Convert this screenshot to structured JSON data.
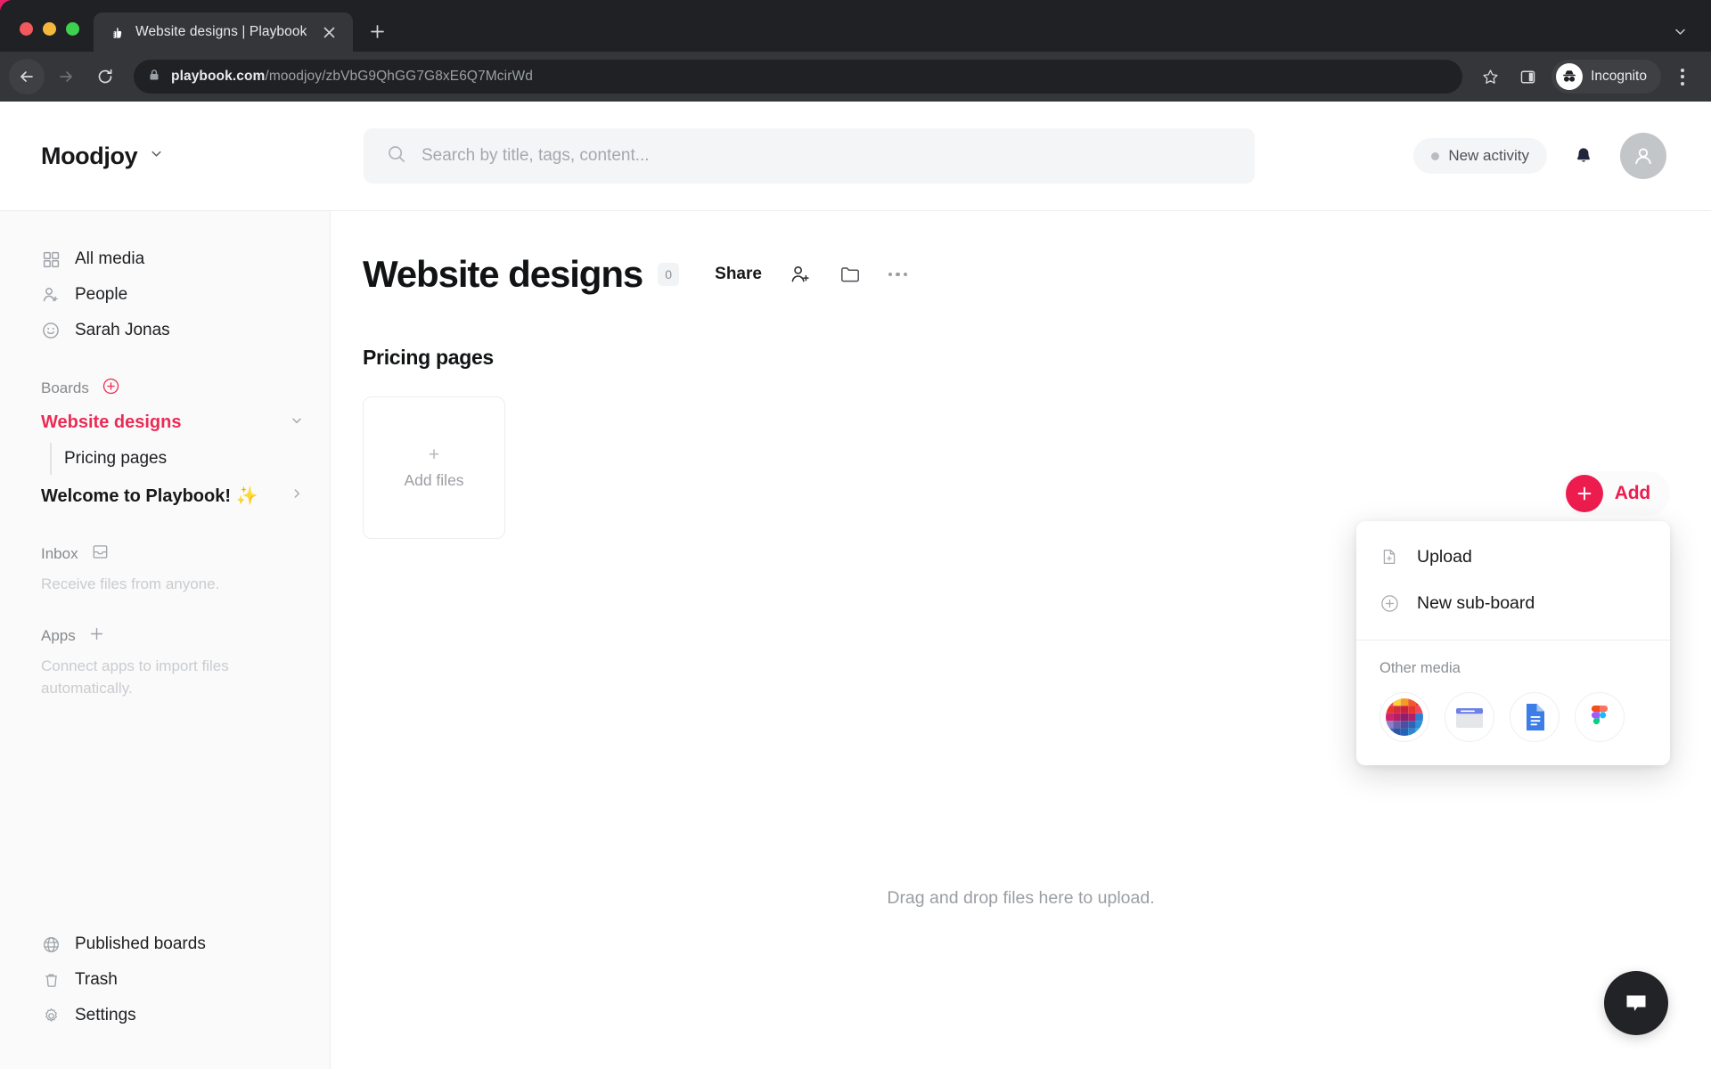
{
  "browser": {
    "tab": {
      "title": "Website designs | Playbook",
      "favicon_icon": "playbook-thumb-icon",
      "close_icon": "close-icon"
    },
    "new_tab_icon": "plus-icon",
    "tab_list_caret_icon": "chevron-down-icon",
    "back_icon": "arrow-left-icon",
    "forward_icon": "arrow-right-icon",
    "reload_icon": "reload-icon",
    "lock_icon": "lock-icon",
    "url_domain": "playbook.com",
    "url_path": "/moodjoy/zbVbG9QhGG7G8xE6Q7McirWd",
    "bookmark_icon": "star-icon",
    "sidepanel_icon": "side-panel-icon",
    "incognito_label": "Incognito",
    "incognito_icon": "incognito-icon",
    "menu_icon": "kebab-menu-icon"
  },
  "header": {
    "brand": "Moodjoy",
    "brand_caret_icon": "chevron-down-icon",
    "search": {
      "placeholder": "Search by title, tags, content...",
      "icon": "search-icon",
      "value": ""
    },
    "activity_label": "New activity",
    "bell_icon": "bell-icon",
    "avatar_icon": "user-avatar-icon"
  },
  "sidebar": {
    "items": [
      {
        "label": "All media",
        "icon": "grid-icon"
      },
      {
        "label": "People",
        "icon": "person-add-icon"
      },
      {
        "label": "Sarah Jonas",
        "icon": "smiley-icon"
      }
    ],
    "boards_label": "Boards",
    "boards_add_icon": "plus-circle-icon",
    "boards": [
      {
        "label": "Website designs",
        "active": true,
        "caret_icon": "chevron-down-icon",
        "children": [
          {
            "label": "Pricing pages"
          }
        ]
      },
      {
        "label": "Welcome to Playbook! ✨",
        "active": false,
        "caret_icon": "chevron-right-icon",
        "children": []
      }
    ],
    "inbox_label": "Inbox",
    "inbox_icon": "inbox-icon",
    "inbox_hint": "Receive files from anyone.",
    "apps_label": "Apps",
    "apps_add_icon": "plus-icon",
    "apps_hint": "Connect apps to import files automatically.",
    "bottom_items": [
      {
        "label": "Published boards",
        "icon": "globe-icon"
      },
      {
        "label": "Trash",
        "icon": "trash-icon"
      },
      {
        "label": "Settings",
        "icon": "gear-icon"
      }
    ]
  },
  "main": {
    "board_title": "Website designs",
    "item_count": "0",
    "share_label": "Share",
    "invite_icon": "person-add-icon",
    "folder_icon": "folder-icon",
    "more_icon": "more-horizontal-icon",
    "section_title": "Pricing pages",
    "add_files_label": "Add files",
    "add_files_plus_icon": "plus-icon",
    "dropzone_text": "Drag and drop files here to upload."
  },
  "add_menu": {
    "button_label": "Add",
    "button_icon": "plus-icon",
    "items": [
      {
        "label": "Upload",
        "icon": "file-upload-icon"
      },
      {
        "label": "New sub-board",
        "icon": "plus-circle-icon"
      }
    ],
    "other_media_label": "Other media",
    "media": [
      {
        "name": "color-palette-icon"
      },
      {
        "name": "web-page-icon"
      },
      {
        "name": "google-docs-icon"
      },
      {
        "name": "figma-icon"
      }
    ]
  },
  "chat": {
    "icon": "chat-bubble-icon"
  },
  "colors": {
    "accent_red": "#ec1c4e",
    "active_board": "#ec2b55",
    "browser_dark": "#202124",
    "browser_tab": "#35363a",
    "sidebar_bg": "#fafafa",
    "page_bg": "#e8206a"
  }
}
